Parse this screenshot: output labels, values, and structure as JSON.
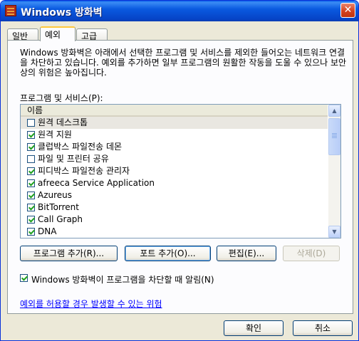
{
  "window": {
    "title": "Windows 방화벽"
  },
  "tabs": [
    {
      "label": "일반",
      "active": false
    },
    {
      "label": "예외",
      "active": true
    },
    {
      "label": "고급",
      "active": false
    }
  ],
  "exceptions": {
    "description": "Windows 방화벽은 아래에서 선택한 프로그램 및 서비스를 제외한 들어오는 네트워크 연결을 차단하고 있습니다. 예외를 추가하면 일부 프로그램의 원활한 작동을 도울 수 있으나 보안상의 위험은 높아집니다.",
    "list_label": "프로그램 및 서비스(P):",
    "column_header": "이름",
    "items": [
      {
        "label": "원격 데스크톱",
        "checked": false,
        "selected": true
      },
      {
        "label": "원격 지원",
        "checked": true,
        "selected": false
      },
      {
        "label": "클럽박스 파일전송 데몬",
        "checked": true,
        "selected": false
      },
      {
        "label": "파일 및 프린터 공유",
        "checked": false,
        "selected": false
      },
      {
        "label": "피디박스 파일전송 관리자",
        "checked": true,
        "selected": false
      },
      {
        "label": "afreeca Service Application",
        "checked": true,
        "selected": false
      },
      {
        "label": "Azureus",
        "checked": true,
        "selected": false
      },
      {
        "label": "BitTorrent",
        "checked": true,
        "selected": false
      },
      {
        "label": "Call Graph",
        "checked": true,
        "selected": false
      },
      {
        "label": "DNA",
        "checked": true,
        "selected": false
      }
    ],
    "buttons": {
      "add_program": "프로그램 추가(R)...",
      "add_port": "포트 추가(O)...",
      "edit": "편집(E)...",
      "delete": "삭제(D)"
    },
    "notify_label": "Windows 방화벽이 프로그램을 차단할 때 알림(N)",
    "notify_checked": true,
    "risk_link": "예외를 허용할 경우 발생할 수 있는 위험"
  },
  "footer": {
    "ok": "확인",
    "cancel": "취소"
  },
  "icons": {
    "app": "firewall-brick-icon",
    "close": "close-icon",
    "scroll_up": "chevron-up-icon",
    "scroll_down": "chevron-down-icon"
  }
}
